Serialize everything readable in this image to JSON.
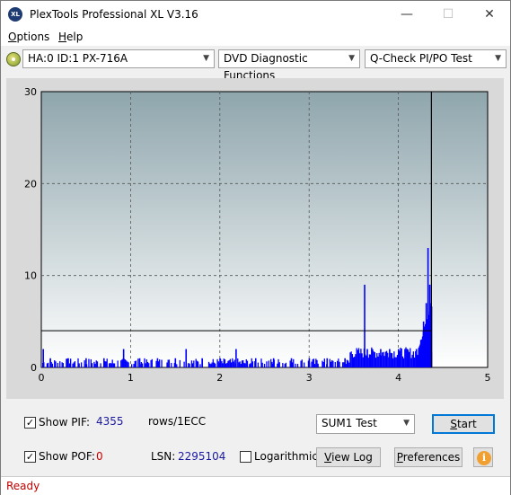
{
  "window": {
    "title": "PlexTools Professional XL V3.16",
    "app_icon_text": "XL"
  },
  "menu": [
    {
      "label": "Options",
      "accel": "O"
    },
    {
      "label": "Help",
      "accel": "H"
    }
  ],
  "toolbar": {
    "drive": "HA:0 ID:1  PX-716A",
    "function": "DVD Diagnostic Functions",
    "test": "Q-Check PI/PO Test"
  },
  "chart_data": {
    "type": "bar",
    "xlim": [
      0,
      5
    ],
    "ylim": [
      0,
      30
    ],
    "x_ticks": [
      "0",
      "1",
      "2",
      "3",
      "4",
      "5"
    ],
    "y_ticks": [
      "0",
      "10",
      "20",
      "30"
    ],
    "grid": true,
    "threshold_line": 4,
    "end_marker_x": 4.37,
    "series_color": "#0000ff",
    "series": [
      {
        "x": 0.02,
        "y": 2
      },
      {
        "x": 0.1,
        "y": 1
      },
      {
        "x": 0.3,
        "y": 1
      },
      {
        "x": 0.5,
        "y": 1
      },
      {
        "x": 0.7,
        "y": 1
      },
      {
        "x": 0.92,
        "y": 2
      },
      {
        "x": 1.1,
        "y": 1
      },
      {
        "x": 1.3,
        "y": 1
      },
      {
        "x": 1.5,
        "y": 1
      },
      {
        "x": 1.62,
        "y": 2
      },
      {
        "x": 1.8,
        "y": 1
      },
      {
        "x": 2.0,
        "y": 1
      },
      {
        "x": 2.18,
        "y": 2
      },
      {
        "x": 2.4,
        "y": 1
      },
      {
        "x": 2.6,
        "y": 1
      },
      {
        "x": 2.8,
        "y": 1
      },
      {
        "x": 3.0,
        "y": 1
      },
      {
        "x": 3.2,
        "y": 1
      },
      {
        "x": 3.4,
        "y": 1
      },
      {
        "x": 3.5,
        "y": 1
      },
      {
        "x": 3.62,
        "y": 9
      },
      {
        "x": 3.65,
        "y": 2
      },
      {
        "x": 3.7,
        "y": 2
      },
      {
        "x": 3.8,
        "y": 2
      },
      {
        "x": 3.9,
        "y": 2
      },
      {
        "x": 4.0,
        "y": 2
      },
      {
        "x": 4.1,
        "y": 2
      },
      {
        "x": 4.2,
        "y": 2
      },
      {
        "x": 4.25,
        "y": 3
      },
      {
        "x": 4.28,
        "y": 5
      },
      {
        "x": 4.31,
        "y": 7
      },
      {
        "x": 4.33,
        "y": 13
      },
      {
        "x": 4.35,
        "y": 9
      }
    ]
  },
  "controls": {
    "show_pif_label": "Show PIF:",
    "pif_value": "4355",
    "rows_label": "rows/1ECC",
    "show_pof_label": "Show POF:",
    "pof_value": "0",
    "lsn_label": "LSN:",
    "lsn_value": "2295104",
    "logarithmic_label": "Logarithmic",
    "sum_select": "SUM1 Test",
    "start_label": "Start",
    "view_log_label": "View Log",
    "preferences_label": "Preferences",
    "pif_checked": true,
    "pof_checked": true,
    "log_checked": false
  },
  "status": {
    "text": "Ready"
  }
}
